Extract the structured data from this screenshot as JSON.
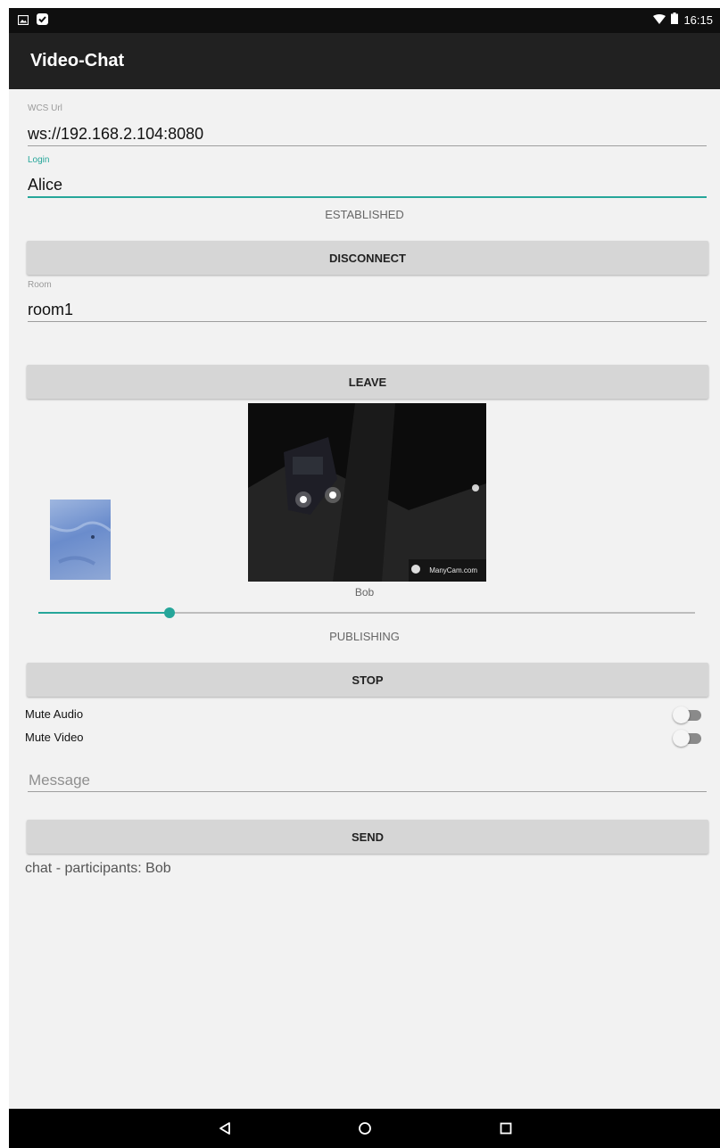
{
  "status_bar": {
    "time": "16:15",
    "icons": [
      "image-notification-icon",
      "check-notification-icon",
      "wifi-icon",
      "battery-icon"
    ]
  },
  "app_bar": {
    "title": "Video-Chat"
  },
  "wcs_url": {
    "label": "WCS Url",
    "value": "ws://192.168.2.104:8080"
  },
  "login": {
    "label": "Login",
    "value": "Alice"
  },
  "connection_status": "ESTABLISHED",
  "connect_button_label": "DISCONNECT",
  "room": {
    "label": "Room",
    "value": "room1"
  },
  "join_button_label": "LEAVE",
  "remote_video": {
    "participant_name": "Bob",
    "watermark": "ManyCam.com"
  },
  "volume_slider": {
    "value_fraction": 0.2
  },
  "publish_status": "PUBLISHING",
  "publish_button_label": "STOP",
  "mute_audio": {
    "label": "Mute Audio",
    "on": false
  },
  "mute_video": {
    "label": "Mute Video",
    "on": false
  },
  "message": {
    "placeholder": "Message",
    "value": ""
  },
  "send_button_label": "SEND",
  "chat_log": "chat - participants: Bob",
  "colors": {
    "accent": "#26a69a",
    "app_bar": "#212121",
    "status_bar": "#0f0f0f",
    "background": "#f2f2f2",
    "button": "#d6d6d6"
  },
  "nav_bar": {
    "icons": [
      "back-icon",
      "home-icon",
      "recents-icon"
    ]
  }
}
